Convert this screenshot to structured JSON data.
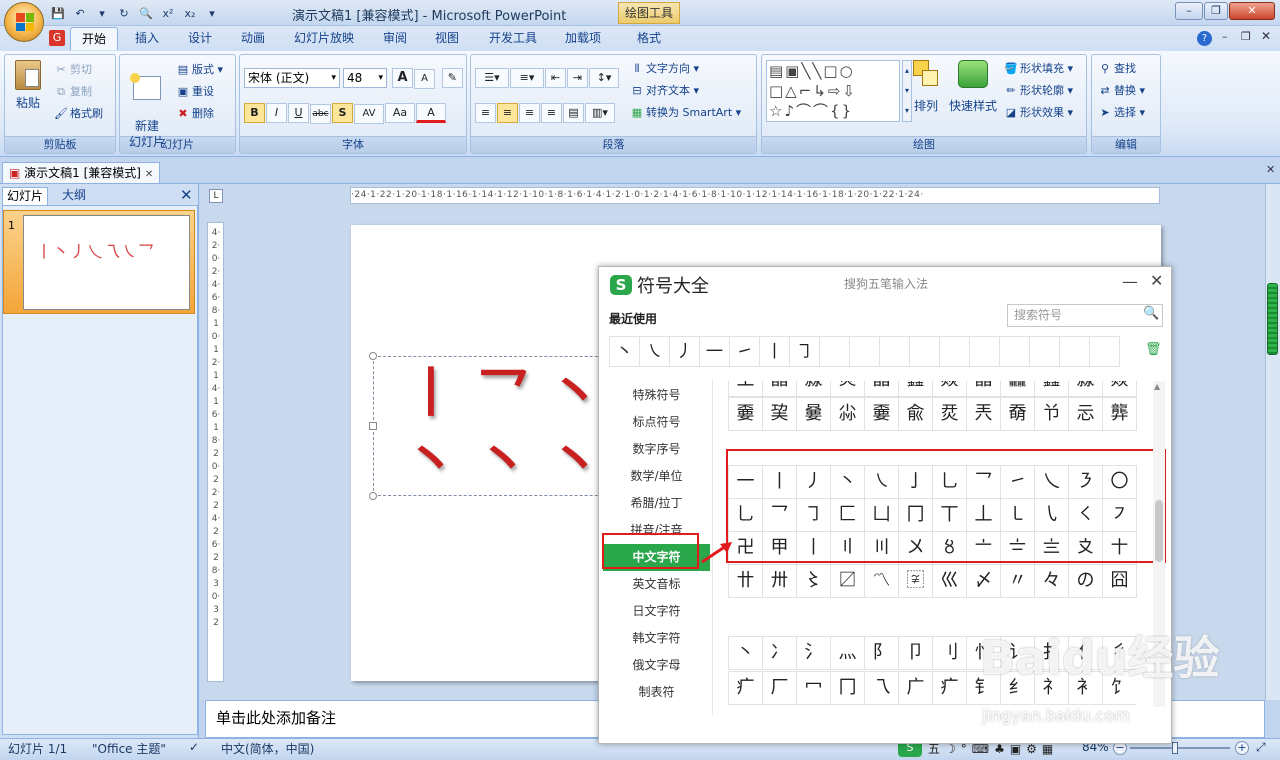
{
  "window": {
    "title": "演示文稿1 [兼容模式] - Microsoft PowerPoint",
    "context_tab": "绘图工具",
    "controls": [
      "–",
      "❐",
      "✕"
    ]
  },
  "ribbon_tabs": [
    "开始",
    "插入",
    "设计",
    "动画",
    "幻灯片放映",
    "审阅",
    "视图",
    "开发工具",
    "加载项",
    "格式"
  ],
  "active_tab": "开始",
  "ribbon": {
    "clipboard": {
      "label": "剪贴板",
      "paste": "粘贴",
      "cut": "剪切",
      "copy": "复制",
      "format_painter": "格式刷"
    },
    "slides": {
      "label": "幻灯片",
      "new_slide": "新建\n幻灯片",
      "layout": "版式",
      "reset": "重设",
      "delete": "删除"
    },
    "font": {
      "label": "字体",
      "font_name": "宋体 (正文)",
      "font_size": "48",
      "bold": "B",
      "italic": "I",
      "underline": "U",
      "strike": "abc",
      "shadow": "S",
      "spacing": "AV",
      "case": "Aa",
      "color": "A",
      "grow": "A",
      "shrink": "A"
    },
    "paragraph": {
      "label": "段落",
      "text_direction": "文字方向",
      "align_text": "对齐文本",
      "smartart": "转换为 SmartArt"
    },
    "drawing": {
      "label": "绘图",
      "arrange": "排列",
      "quick_styles": "快速样式",
      "shape_fill": "形状填充",
      "shape_outline": "形状轮廓",
      "shape_effects": "形状效果"
    },
    "editing": {
      "label": "编辑",
      "find": "查找",
      "replace": "替换",
      "select": "选择"
    }
  },
  "doc_tab": "演示文稿1 [兼容模式]",
  "left_pane": {
    "tabs": [
      "幻灯片",
      "大纲"
    ],
    "slide_number": "1",
    "thumb_text": "丨丶丿乀乁㇏乛"
  },
  "slide": {
    "chars_row1": "丨乛丶丿",
    "chars_row2": "丶丶丶丶"
  },
  "notes_placeholder": "单击此处添加备注",
  "status": {
    "slide": "幻灯片 1/1",
    "theme": "\"Office 主题\"",
    "language": "中文(简体，中国)",
    "zoom": "84%"
  },
  "symbol_dialog": {
    "title": "符号大全",
    "subtitle": "搜狗五笔输入法",
    "recent_label": "最近使用",
    "search_placeholder": "搜索符号",
    "recent": [
      "丶",
      "㇏",
      "丿",
      "一",
      "㇀",
      "丨",
      "㇆",
      "",
      "",
      "",
      "",
      "",
      "",
      "",
      "",
      "",
      ""
    ],
    "categories": [
      "特殊符号",
      "标点符号",
      "数字序号",
      "数学/单位",
      "希腊/拉丁",
      "拼音/注音",
      "中文字符",
      "英文音标",
      "日文字符",
      "韩文字符",
      "俄文字母",
      "制表符"
    ],
    "active_category": "中文字符",
    "grid_top_partial": [
      "王",
      "晶",
      "淼",
      "炎",
      "晶",
      "鑫",
      "焱",
      "晶",
      "龘",
      "鑫",
      "淼",
      "焱"
    ],
    "grid_row1": [
      "嫑",
      "巭",
      "嘦",
      "尛",
      "嫑",
      "兪",
      "烎",
      "兲",
      "奣",
      "兯",
      "忈",
      "龏"
    ],
    "strokes_row1": [
      "一",
      "丨",
      "丿",
      "丶",
      "㇏",
      "亅",
      "乚",
      "乛",
      "㇀",
      "乀",
      "㇋",
      "〇"
    ],
    "strokes_row2": [
      "乚",
      "乛",
      "㇆",
      "匚",
      "凵",
      "冂",
      "丅",
      "丄",
      "㇄",
      "㇂",
      "㇛",
      "㇇"
    ],
    "strokes_row3": [
      "卍",
      "甲",
      "丨",
      "〢",
      "〣",
      "〤",
      "〥",
      "〦",
      "〧",
      "〨",
      "〩",
      "〸"
    ],
    "strokes_row4": [
      "〹",
      "〺",
      "〻",
      "〼",
      "〽",
      "〾",
      "巛",
      "〆",
      "〃",
      "々",
      "の",
      "囧"
    ],
    "radicals_row1": [
      "丶",
      "冫",
      "氵",
      "灬",
      "阝",
      "卩",
      "刂",
      "忄",
      "讠",
      "扌",
      "亻",
      "彳"
    ],
    "radicals_row2": [
      "疒",
      "厂",
      "冖",
      "冂",
      "乁",
      "广",
      "疒",
      "钅",
      "纟",
      "礻",
      "衤",
      "饣"
    ]
  },
  "watermark": {
    "main": "Baidu经验",
    "sub": "jingyan.baidu.com"
  },
  "colors": {
    "accent_green": "#2aa64b",
    "highlight_red": "#e21b1b",
    "slide_text_red": "#c92020"
  }
}
